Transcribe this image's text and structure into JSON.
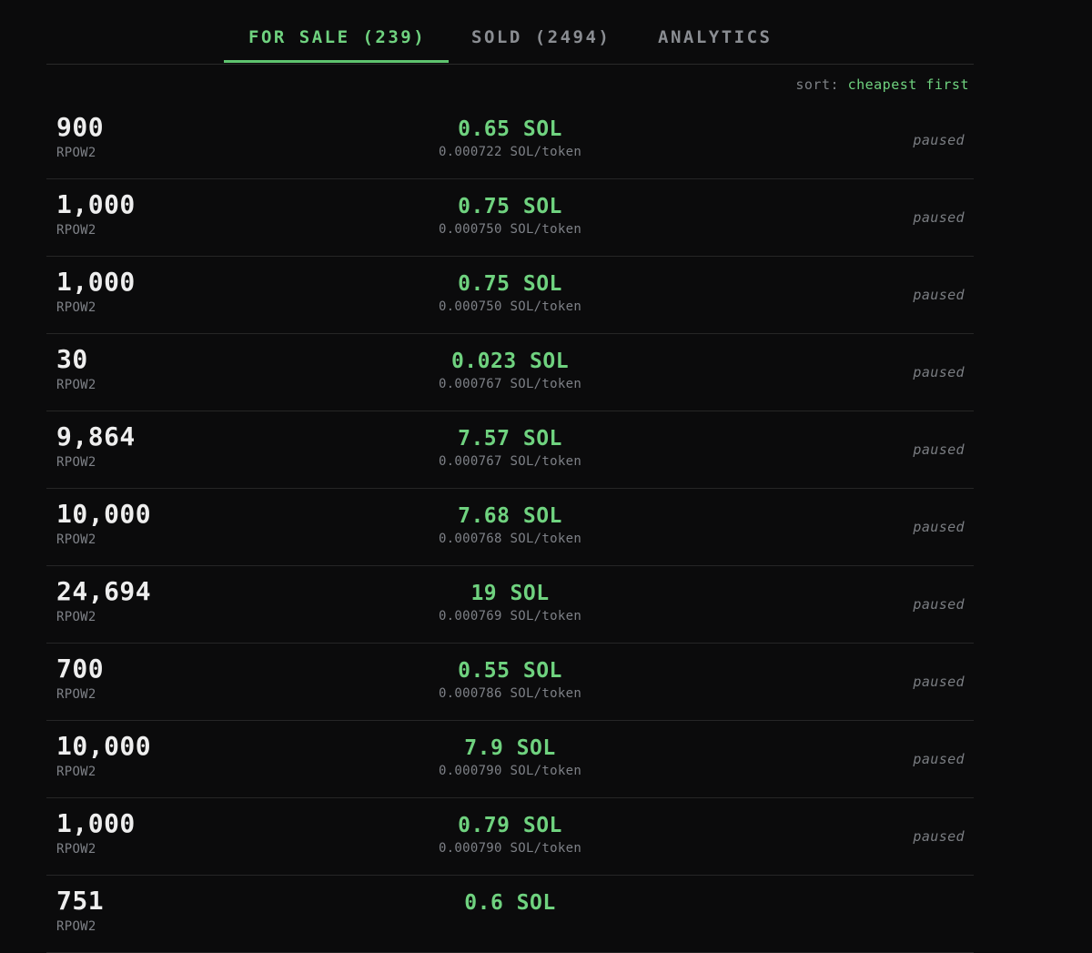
{
  "tabs": [
    {
      "label": "FOR SALE (239)",
      "active": true
    },
    {
      "label": "SOLD (2494)",
      "active": false
    },
    {
      "label": "ANALYTICS",
      "active": false
    }
  ],
  "sort": {
    "label": "sort:",
    "value": "cheapest first"
  },
  "colors": {
    "accent": "#6fd27f",
    "background": "#0b0b0c",
    "muted": "#7e8187"
  },
  "listings": [
    {
      "amount": "900",
      "ticker": "RPOW2",
      "price": "0.65 SOL",
      "unit_price": "0.000722 SOL/token",
      "status": "paused"
    },
    {
      "amount": "1,000",
      "ticker": "RPOW2",
      "price": "0.75 SOL",
      "unit_price": "0.000750 SOL/token",
      "status": "paused"
    },
    {
      "amount": "1,000",
      "ticker": "RPOW2",
      "price": "0.75 SOL",
      "unit_price": "0.000750 SOL/token",
      "status": "paused"
    },
    {
      "amount": "30",
      "ticker": "RPOW2",
      "price": "0.023 SOL",
      "unit_price": "0.000767 SOL/token",
      "status": "paused"
    },
    {
      "amount": "9,864",
      "ticker": "RPOW2",
      "price": "7.57 SOL",
      "unit_price": "0.000767 SOL/token",
      "status": "paused"
    },
    {
      "amount": "10,000",
      "ticker": "RPOW2",
      "price": "7.68 SOL",
      "unit_price": "0.000768 SOL/token",
      "status": "paused"
    },
    {
      "amount": "24,694",
      "ticker": "RPOW2",
      "price": "19 SOL",
      "unit_price": "0.000769 SOL/token",
      "status": "paused"
    },
    {
      "amount": "700",
      "ticker": "RPOW2",
      "price": "0.55 SOL",
      "unit_price": "0.000786 SOL/token",
      "status": "paused"
    },
    {
      "amount": "10,000",
      "ticker": "RPOW2",
      "price": "7.9 SOL",
      "unit_price": "0.000790 SOL/token",
      "status": "paused"
    },
    {
      "amount": "1,000",
      "ticker": "RPOW2",
      "price": "0.79 SOL",
      "unit_price": "0.000790 SOL/token",
      "status": "paused"
    },
    {
      "amount": "751",
      "ticker": "RPOW2",
      "price": "0.6 SOL",
      "unit_price": "",
      "status": ""
    }
  ]
}
